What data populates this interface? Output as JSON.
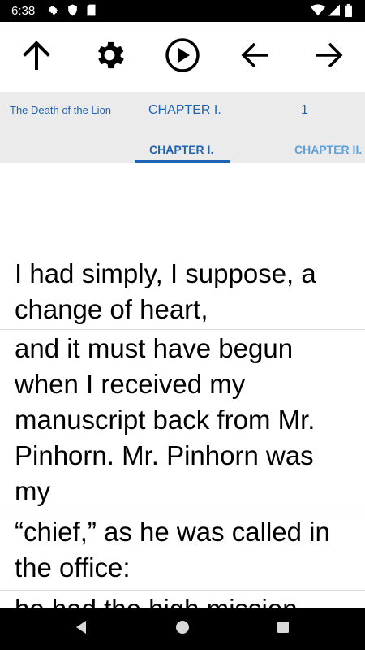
{
  "status": {
    "time": "6:38"
  },
  "toolbar": {
    "buttons": [
      "up-arrow-icon",
      "gear-icon",
      "play-icon",
      "arrow-left-icon",
      "arrow-right-icon"
    ]
  },
  "info": {
    "book_title": "The Death of the Lion",
    "chapter_title": "CHAPTER I.",
    "page_number": "1"
  },
  "tabs": [
    {
      "label": "CHAPTER I.",
      "selected": true
    },
    {
      "label": "CHAPTER II.",
      "selected": false
    }
  ],
  "paragraphs": [
    " I had simply, I suppose, a change of heart,",
    " and it must have begun when I received my manuscript back from Mr. Pinhorn.  Mr. Pinhorn was my",
    " “chief,” as he was called in the office:",
    " he had the high mission"
  ],
  "colors": {
    "accent": "#1e64b4",
    "tab_inactive": "#5fa0d8",
    "strip_bg": "#ebebeb"
  }
}
